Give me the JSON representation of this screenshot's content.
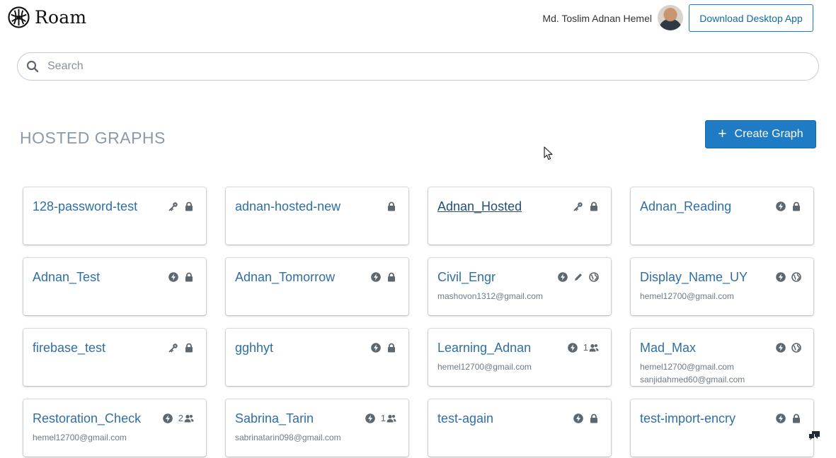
{
  "app": {
    "name": "Roam"
  },
  "header": {
    "user_name": "Md. Toslim Adnan Hemel",
    "download_label": "Download Desktop App"
  },
  "search": {
    "placeholder": "Search",
    "value": ""
  },
  "section": {
    "title": "HOSTED GRAPHS"
  },
  "create_button": {
    "label": "Create Graph"
  },
  "graphs": [
    {
      "name": "128-password-test",
      "icons": [
        "key-icon",
        "lock-icon"
      ],
      "emails": []
    },
    {
      "name": "adnan-hosted-new",
      "icons": [
        "lock-icon"
      ],
      "emails": []
    },
    {
      "name": "Adnan_Hosted",
      "icons": [
        "key-icon",
        "lock-icon"
      ],
      "emails": [],
      "underlined": true
    },
    {
      "name": "Adnan_Reading",
      "icons": [
        "bolt-icon",
        "lock-icon"
      ],
      "emails": []
    },
    {
      "name": "Adnan_Test",
      "icons": [
        "bolt-icon",
        "lock-icon"
      ],
      "emails": []
    },
    {
      "name": "Adnan_Tomorrow",
      "icons": [
        "bolt-icon",
        "lock-icon"
      ],
      "emails": []
    },
    {
      "name": "Civil_Engr",
      "icons": [
        "bolt-icon",
        "pencil-icon",
        "globe-icon"
      ],
      "emails": [
        "mashovon1312@gmail.com"
      ]
    },
    {
      "name": "Display_Name_UY",
      "icons": [
        "bolt-icon",
        "globe-icon"
      ],
      "emails": [
        "hemel12700@gmail.com"
      ]
    },
    {
      "name": "firebase_test",
      "icons": [
        "key-icon",
        "lock-icon"
      ],
      "emails": []
    },
    {
      "name": "gghhyt",
      "icons": [
        "bolt-icon",
        "lock-icon"
      ],
      "emails": []
    },
    {
      "name": "Learning_Adnan",
      "icons": [
        "bolt-icon",
        "people-icon"
      ],
      "share_count": "1",
      "emails": [
        "hemel12700@gmail.com"
      ]
    },
    {
      "name": "Mad_Max",
      "icons": [
        "bolt-icon",
        "globe-icon"
      ],
      "emails": [
        "hemel12700@gmail.com",
        "sanjidahmed60@gmail.com"
      ]
    },
    {
      "name": "Restoration_Check",
      "icons": [
        "bolt-icon",
        "people-icon"
      ],
      "share_count": "2",
      "emails": [
        "hemel12700@gmail.com"
      ]
    },
    {
      "name": "Sabrina_Tarin",
      "icons": [
        "bolt-icon",
        "people-icon"
      ],
      "share_count": "1",
      "emails": [
        "sabrinatarin098@gmail.com"
      ]
    },
    {
      "name": "test-again",
      "icons": [
        "bolt-icon",
        "lock-icon"
      ],
      "emails": []
    },
    {
      "name": "test-import-encry",
      "icons": [
        "bolt-icon",
        "lock-icon"
      ],
      "emails": []
    }
  ],
  "colors": {
    "accent": "#1f7bc4",
    "link": "#2f6fa5",
    "icon": "#5c6770",
    "section_title": "#8a9aaa"
  }
}
